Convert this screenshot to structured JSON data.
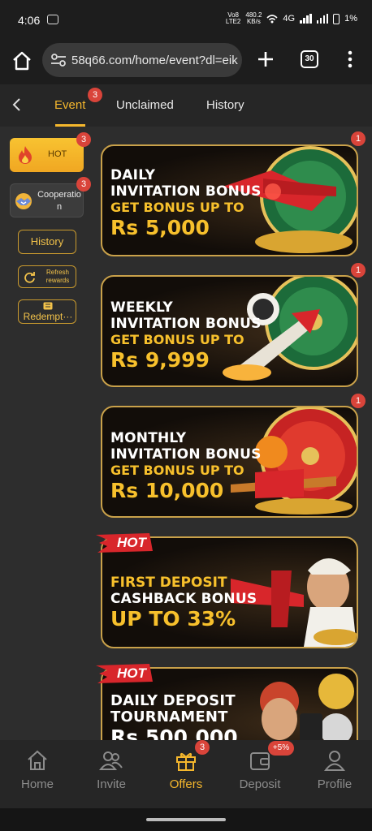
{
  "status_bar": {
    "time": "4:06",
    "volte": "Vo8\nLTE2",
    "speed_top": "480.2",
    "speed_bottom": "KB/s",
    "network": "4G",
    "battery": "1%"
  },
  "browser": {
    "url": "58q66.com/home/event?dl=eik",
    "tab_count": "30"
  },
  "header": {
    "tabs": [
      {
        "label": "Event",
        "badge": "3"
      },
      {
        "label": "Unclaimed"
      },
      {
        "label": "History"
      }
    ]
  },
  "sidebar": {
    "hot": {
      "label": "HOT",
      "badge": "3"
    },
    "cooperation": {
      "label": "Cooperatio\nn",
      "badge": "3"
    },
    "history_label": "History",
    "refresh_label": "Refresh rewards",
    "redemption_label": "Redempt···"
  },
  "banners": [
    {
      "badge": "1",
      "line1": "DAILY",
      "line2": "INVITATION BONUS",
      "line3": "GET BONUS UP TO",
      "amount": "Rs 5,000"
    },
    {
      "badge": "1",
      "line1": "WEEKLY",
      "line2": "INVITATION BONUS",
      "line3": "GET BONUS UP TO",
      "amount": "Rs 9,999"
    },
    {
      "badge": "1",
      "line1": "MONTHLY",
      "line2": "INVITATION BONUS",
      "line3": "GET BONUS UP TO",
      "amount": "Rs 10,000"
    },
    {
      "tag": "HOT",
      "line1": "FIRST DEPOSIT",
      "line2": "CASHBACK BONUS",
      "amount": "UP TO 33%"
    },
    {
      "tag": "HOT",
      "line1": "DAILY DEPOSIT",
      "line2": "TOURNAMENT",
      "amount": "Rs 500,000"
    }
  ],
  "bottom_nav": {
    "items": [
      {
        "label": "Home",
        "icon": "home-icon"
      },
      {
        "label": "Invite",
        "icon": "people-icon"
      },
      {
        "label": "Offers",
        "icon": "gift-icon",
        "badge": "3"
      },
      {
        "label": "Deposit",
        "icon": "wallet-icon",
        "badge": "+5%"
      },
      {
        "label": "Profile",
        "icon": "profile-icon"
      }
    ]
  },
  "colors": {
    "accent": "#f5b72d",
    "badge": "#d9443a",
    "background": "#2d2d2d"
  }
}
